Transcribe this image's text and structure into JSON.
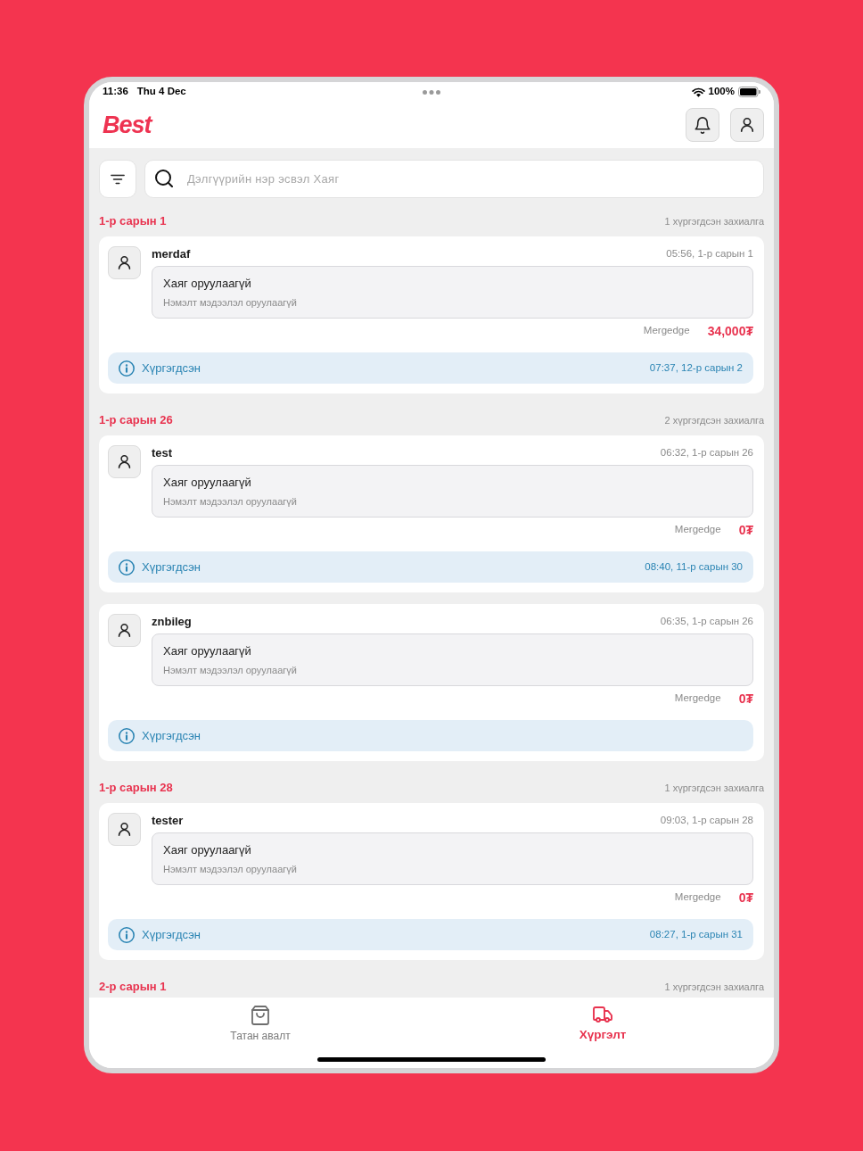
{
  "status_bar": {
    "time": "11:36",
    "date": "Thu 4 Dec",
    "battery": "100%"
  },
  "header": {
    "logo": "Best"
  },
  "search": {
    "placeholder": "Дэлгүүрийн нэр эсвэл Хаяг"
  },
  "groups": [
    {
      "date": "1-р сарын 1",
      "summary": "1 хүргэгдсэн захиалга",
      "orders": [
        {
          "customer": "merdaf",
          "time": "05:56, 1-р сарын 1",
          "address": "Хаяг оруулаагүй",
          "note": "Нэмэлт мэдээлэл оруулаагүй",
          "method": "Mergedge",
          "amount": "34,000₮",
          "status": "Хүргэгдсэн",
          "delivered_at": "07:37, 12-р сарын 2"
        }
      ]
    },
    {
      "date": "1-р сарын 26",
      "summary": "2 хүргэгдсэн захиалга",
      "orders": [
        {
          "customer": "test",
          "time": "06:32, 1-р сарын 26",
          "address": "Хаяг оруулаагүй",
          "note": "Нэмэлт мэдээлэл оруулаагүй",
          "method": "Mergedge",
          "amount": "0₮",
          "status": "Хүргэгдсэн",
          "delivered_at": "08:40, 11-р сарын 30"
        },
        {
          "customer": "znbileg",
          "time": "06:35, 1-р сарын 26",
          "address": "Хаяг оруулаагүй",
          "note": "Нэмэлт мэдээлэл оруулаагүй",
          "method": "Mergedge",
          "amount": "0₮",
          "status": "Хүргэгдсэн"
        }
      ]
    },
    {
      "date": "1-р сарын 28",
      "summary": "1 хүргэгдсэн захиалга",
      "orders": [
        {
          "customer": "tester",
          "time": "09:03, 1-р сарын 28",
          "address": "Хаяг оруулаагүй",
          "note": "Нэмэлт мэдээлэл оруулаагүй",
          "method": "Mergedge",
          "amount": "0₮",
          "status": "Хүргэгдсэн",
          "delivered_at": "08:27, 1-р сарын 31"
        }
      ]
    },
    {
      "date": "2-р сарын 1",
      "summary": "1 хүргэгдсэн захиалга"
    }
  ],
  "bottom_nav": [
    {
      "label": "Татан авалт",
      "selected": false
    },
    {
      "label": "Хүргэлт",
      "selected": true
    }
  ]
}
